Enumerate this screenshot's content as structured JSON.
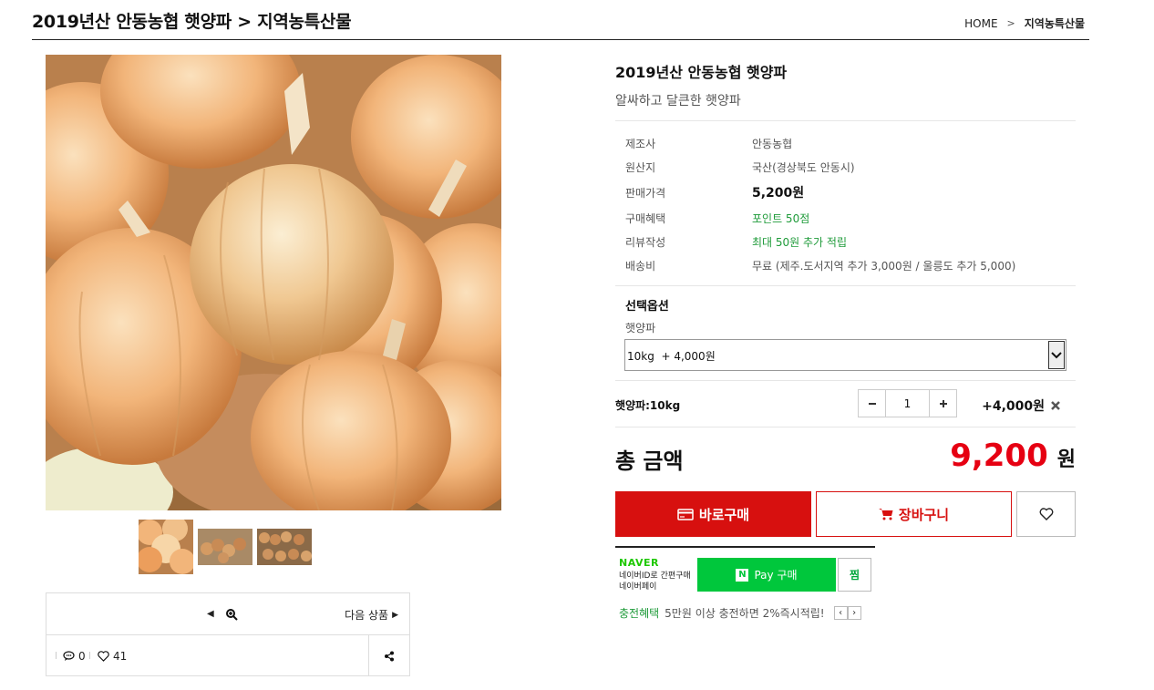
{
  "header": {
    "title": "2019년산 안동농협 햇양파 > 지역농특산물",
    "breadcrumb": {
      "home": "HOME",
      "sep": ">",
      "current": "지역농특산물"
    }
  },
  "product": {
    "name": "2019년산 안동농협 햇양파",
    "subtitle": "알싸하고 달큰한 햇양파",
    "specs": [
      {
        "label": "제조사",
        "value": "안동농협"
      },
      {
        "label": "원산지",
        "value": "국산(경상북도 안동시)"
      },
      {
        "label": "판매가격",
        "value": "5,200원"
      },
      {
        "label": "구매혜택",
        "value": "포인트 50점"
      },
      {
        "label": "리뷰작성",
        "value": "최대 50원 추가 적립"
      },
      {
        "label": "배송비",
        "value": "무료 (제주.도서지역 추가 3,000원 / 울릉도 추가 5,000)"
      }
    ]
  },
  "options": {
    "title": "선택옵션",
    "label": "햇양파",
    "selected": "10kg  + 4,000원"
  },
  "selection": {
    "name": "햇양파:10kg",
    "quantity": "1",
    "price": "+4,000원"
  },
  "total": {
    "label": "총 금액",
    "value": "9,200",
    "unit": "원"
  },
  "buttons": {
    "buy": "바로구매",
    "cart": "장바구니"
  },
  "npay": {
    "logo": "NAVER",
    "desc": "네이버ID로 간편구매 네이버페이",
    "btn_n": "N",
    "btn": "Pay 구매",
    "jjim": "찜",
    "promo_tag": "충전혜택",
    "promo_text": "5만원 이상 충전하면 2%즉시적립!"
  },
  "nav": {
    "next": "다음 상품",
    "comments": "0",
    "likes": "41"
  },
  "colors": {
    "accent_red": "#d7100f",
    "price_red": "#e60012",
    "naver_green": "#00c73c",
    "benefit_green": "#1f9b3a"
  },
  "icons": [
    "prev-arrow-icon",
    "zoom-icon",
    "next-arrow-icon",
    "comment-icon",
    "heart-icon",
    "share-icon",
    "minus-icon",
    "plus-icon",
    "close-icon",
    "card-icon",
    "cart-icon",
    "chevron-down-icon"
  ]
}
